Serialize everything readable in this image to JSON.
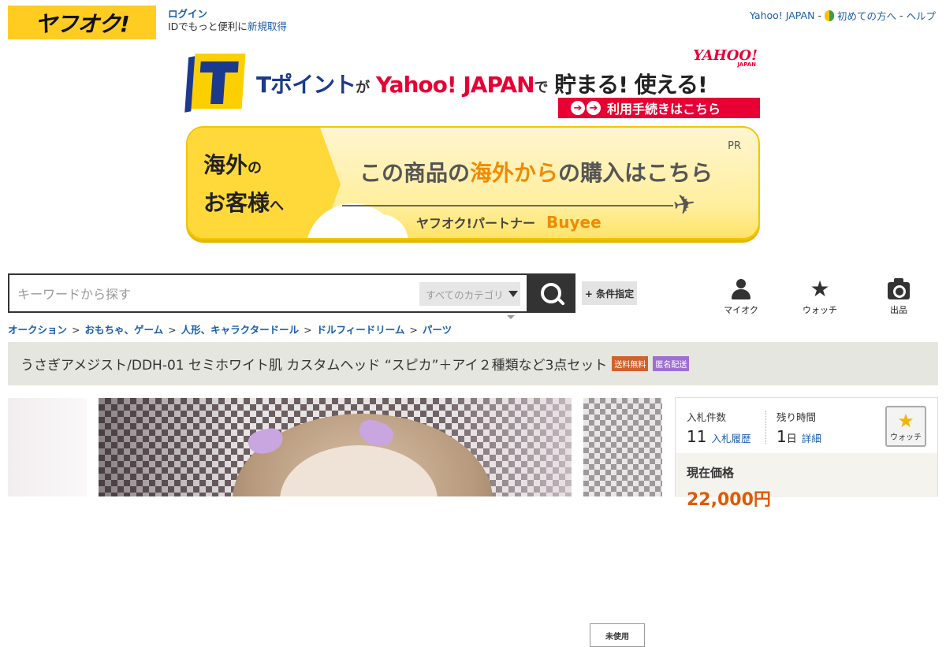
{
  "header": {
    "logo": "ヤフオク!",
    "login": "ログイン",
    "login_sub": "IDでもっと便利に",
    "signup": "新規取得",
    "links": [
      "Yahoo! JAPAN",
      "初めての方へ",
      "ヘルプ"
    ],
    "link_sep": "-"
  },
  "tpoint_banner": {
    "tp": "Tポイント",
    "ga": "が",
    "yj": "Yahoo! JAPAN",
    "de": "で",
    "tm": "貯まる! 使える!",
    "yahoo_logo": "YAHOO!",
    "yahoo_logo_sub": "JAPAN",
    "button": "利用手続きはこちら"
  },
  "buyee_banner": {
    "left_line1": "海外",
    "left_no": "の",
    "left_line2": "お客様",
    "left_he": "へ",
    "pr": "PR",
    "msg_pre": "この商品の",
    "msg_hl": "海外から",
    "msg_post": "の購入はこちら",
    "partner": "ヤフオク!パートナー",
    "buyee_logo": "Buyee"
  },
  "search": {
    "placeholder": "キーワードから探す",
    "category": "すべてのカテゴリ",
    "condition_button": "+ 条件指定"
  },
  "nav_icons": [
    {
      "label": "マイオク",
      "icon": "user-icon"
    },
    {
      "label": "ウォッチ",
      "icon": "star-icon"
    },
    {
      "label": "出品",
      "icon": "camera-icon"
    }
  ],
  "breadcrumb": [
    "オークション",
    "おもちゃ、ゲーム",
    "人形、キャラクタードール",
    "ドルフィードリーム",
    "パーツ"
  ],
  "breadcrumb_sep": ">",
  "item": {
    "title": "うさぎアメジスト/DDH-01 セミホワイト肌 カスタムヘッド “スピカ”＋アイ２種類など3点セット",
    "tags": [
      "送料無料",
      "匿名配送",
      "未使用"
    ]
  },
  "bid": {
    "count_label": "入札件数",
    "count": "11",
    "history_link": "入札履歴",
    "remaining_label": "残り時間",
    "remaining_num": "1",
    "remaining_unit": "日",
    "detail_link": "詳細",
    "watch_label": "ウォッチ",
    "price_label": "現在価格",
    "price": "22,000円"
  },
  "colors": {
    "brand_yellow": "#ffcc22",
    "link_blue": "#1a5ea9",
    "tpoint_red": "#e60033",
    "tpoint_navy": "#1b3a8f",
    "buyee_orange": "#f08a00",
    "tag_ship": "#d0622c",
    "tag_anon": "#9d6fd4"
  }
}
